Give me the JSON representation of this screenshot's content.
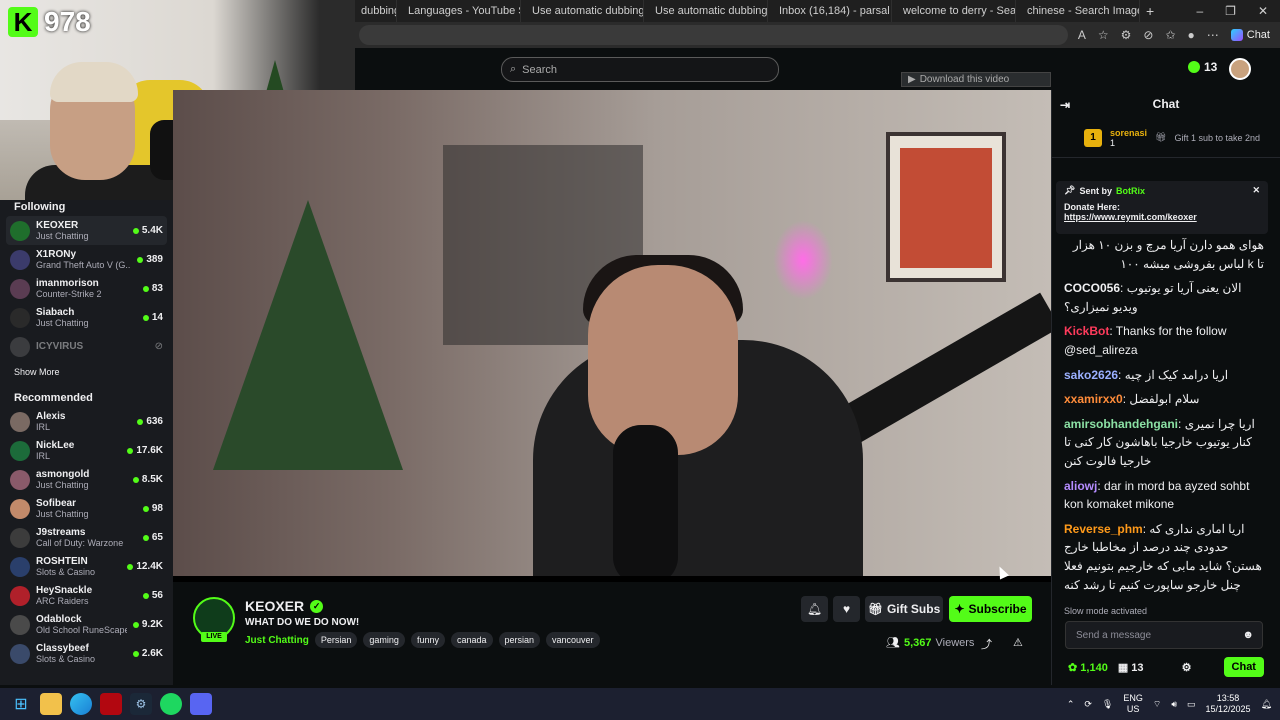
{
  "overlay": {
    "kick_letter": "K",
    "followers_count": "978"
  },
  "browser": {
    "tabs": [
      {
        "title": "dubbing",
        "icon_color": "#8ab4f8"
      },
      {
        "title": "Languages - YouTube S",
        "icon_color": "#ff0000"
      },
      {
        "title": "Use automatic dubbing",
        "icon_color": "#4285f4"
      },
      {
        "title": "Use automatic dubbing",
        "icon_color": "#4285f4"
      },
      {
        "title": "Inbox (16,184) - parsal",
        "icon_color": "#ea4335"
      },
      {
        "title": "welcome to derry - Sea",
        "icon_color": "#8ab4f8"
      },
      {
        "title": "chinese - Search Image",
        "icon_color": "#8ab4f8"
      }
    ],
    "new_tab": "+",
    "window_controls": [
      "–",
      "❐",
      "✕"
    ],
    "copilot_label": "Chat"
  },
  "kick": {
    "search_placeholder": "Search",
    "download_label": "Download this video",
    "header_points": "13"
  },
  "sidebar": {
    "following_title": "Following",
    "following": [
      {
        "name": "KEOXER",
        "category": "Just Chatting",
        "viewers": "5.4K",
        "color": "#1f6e2c",
        "active": true
      },
      {
        "name": "X1RONy",
        "category": "Grand Theft Auto V (G...",
        "viewers": "389",
        "color": "#3b3b6b"
      },
      {
        "name": "imanmorison",
        "category": "Counter-Strike 2",
        "viewers": "83",
        "color": "#5a3c52"
      },
      {
        "name": "Siabach",
        "category": "Just Chatting",
        "viewers": "14",
        "color": "#2a2a2a"
      }
    ],
    "offline": {
      "name": "ICYVIRUS",
      "icon": "video-off-icon"
    },
    "show_more": "Show More",
    "recommended_title": "Recommended",
    "recommended": [
      {
        "name": "Alexis",
        "category": "IRL",
        "viewers": "636",
        "color": "#7a6a63"
      },
      {
        "name": "NickLee",
        "category": "IRL",
        "viewers": "17.6K",
        "color": "#1c6b3a"
      },
      {
        "name": "asmongold",
        "category": "Just Chatting",
        "viewers": "8.5K",
        "color": "#8a5a6a"
      },
      {
        "name": "Sofibear",
        "category": "Just Chatting",
        "viewers": "98",
        "color": "#c28a6a"
      },
      {
        "name": "J9streams",
        "category": "Call of Duty: Warzone",
        "viewers": "65",
        "color": "#3c3c3c"
      },
      {
        "name": "ROSHTEIN",
        "category": "Slots & Casino",
        "viewers": "12.4K",
        "color": "#2a3f6b"
      },
      {
        "name": "HeySnackle",
        "category": "ARC Raiders",
        "viewers": "56",
        "color": "#b0202a"
      },
      {
        "name": "Odablock",
        "category": "Old School RuneScape",
        "viewers": "9.2K",
        "color": "#4a4a4a"
      },
      {
        "name": "Classybeef",
        "category": "Slots & Casino",
        "viewers": "2.6K",
        "color": "#3a4a6a"
      }
    ]
  },
  "stream": {
    "channel": "KEOXER",
    "live_label": "LIVE",
    "title": "WHAT DO WE DO NOW!",
    "category": "Just Chatting",
    "tags": [
      "Persian",
      "gaming",
      "funny",
      "canada",
      "persian",
      "vancouver"
    ],
    "gift_label": "Gift Subs",
    "subscribe_label": "Subscribe",
    "viewer_count": "5,367",
    "viewer_label": "Viewers"
  },
  "chat": {
    "title": "Chat",
    "top_gifter": {
      "rank": "1",
      "name": "sorenasi",
      "count": "1",
      "gift_text": "Gift 1 sub to take 2nd"
    },
    "pinned": {
      "sent_by": "Sent by",
      "bot_name": "BotRix",
      "donate": "Donate Here:",
      "link": "https://www.reymit.com/keoxer"
    },
    "messages": [
      {
        "user": "",
        "color": "#efeff1",
        "text": "هوای همو دارن آریا مرچ و بزن ۱۰ هزار تا k لباس بفروشی میشه ۱۰۰",
        "rtl": true
      },
      {
        "user": "COCO056",
        "color": "#efeff1",
        "text": "الان یعنی آریا تو یوتیوب ویدیو نمیزاری؟",
        "rtl": false
      },
      {
        "user": "KickBot",
        "color": "#ff3b5c",
        "text": "Thanks for the follow @sed_alireza",
        "rtl": false
      },
      {
        "user": "sako2626",
        "color": "#9bb0ff",
        "text": "اریا درامد کیک از چیه",
        "rtl": false
      },
      {
        "user": "xxamirxx0",
        "color": "#ff8c3a",
        "text": "سلام ابولفضل",
        "rtl": false
      },
      {
        "user": "amirsobhandehgani",
        "color": "#8be0a4",
        "text": "اریا چرا نمیری کنار یوتیوب خارجیا باهاشون کار کنی تا خارجیا فالوت کنن",
        "rtl": false
      },
      {
        "user": "aliowj",
        "color": "#b58cff",
        "text": "dar in mord ba ayzed sohbt kon komaket mikone",
        "rtl": false
      },
      {
        "user": "Reverse_phm",
        "color": "#ff9a1a",
        "text": "اریا اماری نداری که حدودی چند درصد از مخاطبا خارج هستن؟ شاید مابی که خارجیم بتونیم فعلا چنل خارجو ساپورت کنیم تا رشد کنه",
        "rtl": false
      }
    ],
    "slow_mode": "Slow mode activated",
    "input_placeholder": "Send a message",
    "points": "1,140",
    "gifts": "13",
    "chat_button": "Chat"
  },
  "taskbar": {
    "language_top": "ENG",
    "language_bottom": "US",
    "time": "13:58",
    "date": "15/12/2025",
    "apps": [
      "windows-icon",
      "file-explorer-icon",
      "edge-icon",
      "netflix-icon",
      "steam-icon",
      "spotify-icon",
      "discord-icon"
    ]
  },
  "colors": {
    "kick_green": "#53fc18",
    "bg": "#0b0e0f",
    "panel": "#191b1f"
  }
}
